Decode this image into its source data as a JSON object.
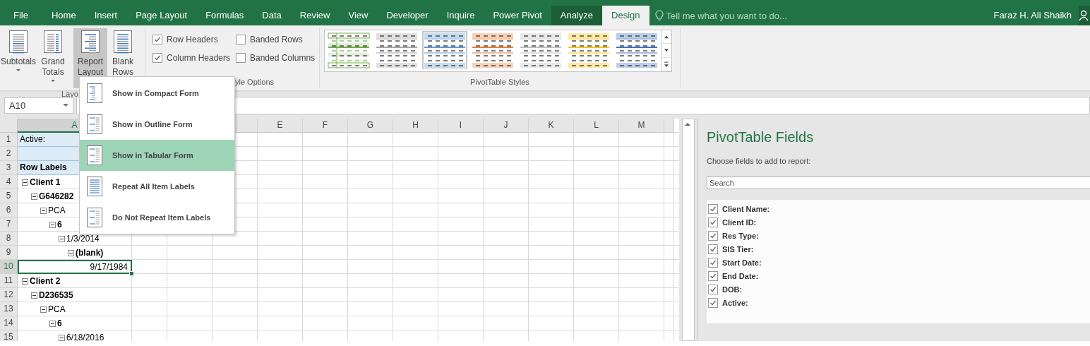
{
  "ribbon_tabs": [
    {
      "label": "File",
      "selected": false,
      "kind": "file"
    },
    {
      "label": "Home",
      "selected": false,
      "kind": "tab"
    },
    {
      "label": "Insert",
      "selected": false,
      "kind": "tab"
    },
    {
      "label": "Page Layout",
      "selected": false,
      "kind": "tab"
    },
    {
      "label": "Formulas",
      "selected": false,
      "kind": "tab"
    },
    {
      "label": "Data",
      "selected": false,
      "kind": "tab"
    },
    {
      "label": "Review",
      "selected": false,
      "kind": "tab"
    },
    {
      "label": "View",
      "selected": false,
      "kind": "tab"
    },
    {
      "label": "Developer",
      "selected": false,
      "kind": "tab"
    },
    {
      "label": "Inquire",
      "selected": false,
      "kind": "tab"
    },
    {
      "label": "Power Pivot",
      "selected": false,
      "kind": "tab"
    },
    {
      "label": "Analyze",
      "selected": false,
      "kind": "contextual"
    },
    {
      "label": "Design",
      "selected": true,
      "kind": "contextual"
    }
  ],
  "tell_me": {
    "placeholder": "Tell me what you want to do..."
  },
  "user_name": "Faraz H. Ali Shaikh",
  "layout_group": {
    "label": "Layo",
    "buttons": [
      {
        "label": "Subtotals",
        "pressed": false
      },
      {
        "label": "Grand Totals",
        "pressed": false
      },
      {
        "label": "Report Layout",
        "pressed": true
      },
      {
        "label": "Blank Rows",
        "pressed": false
      }
    ]
  },
  "style_options_group": {
    "label": "yle Options",
    "options": [
      {
        "label": "Row Headers",
        "checked": true
      },
      {
        "label": "Column Headers",
        "checked": true
      },
      {
        "label": "Banded Rows",
        "checked": false
      },
      {
        "label": "Banded Columns",
        "checked": false
      }
    ]
  },
  "styles_group": {
    "label": "PivotTable Styles",
    "styles": [
      {
        "color": "#70ad47",
        "selected": false
      },
      {
        "color": "#a5a5a5",
        "selected": false
      },
      {
        "color": "#5b9bd5",
        "selected": true
      },
      {
        "color": "#ed7d31",
        "selected": false
      },
      {
        "color": "#bfbfbf",
        "selected": false
      },
      {
        "color": "#ffc000",
        "selected": false
      },
      {
        "color": "#4472c4",
        "selected": false
      }
    ]
  },
  "report_layout_menu": [
    {
      "label": "Show in Compact Form",
      "selected": false,
      "kind": "compact"
    },
    {
      "label": "Show in Outline Form",
      "selected": false,
      "kind": "outline"
    },
    {
      "label": "Show in Tabular Form",
      "selected": true,
      "kind": "tabular"
    },
    {
      "label": "Repeat All Item Labels",
      "selected": false,
      "kind": "repeat"
    },
    {
      "label": "Do Not Repeat Item Labels",
      "selected": false,
      "kind": "norepeat"
    }
  ],
  "name_box": "A10",
  "column_headers": [
    {
      "label": "A",
      "selected": true
    },
    {
      "label": "E",
      "selected": false
    },
    {
      "label": "F",
      "selected": false
    },
    {
      "label": "G",
      "selected": false
    },
    {
      "label": "H",
      "selected": false
    },
    {
      "label": "I",
      "selected": false
    },
    {
      "label": "J",
      "selected": false
    },
    {
      "label": "K",
      "selected": false
    },
    {
      "label": "L",
      "selected": false
    },
    {
      "label": "M",
      "selected": false
    }
  ],
  "row_numbers": [
    "1",
    "2",
    "3",
    "4",
    "5",
    "6",
    "7",
    "8",
    "9",
    "10",
    "11",
    "12",
    "13",
    "14",
    "15"
  ],
  "pivot": {
    "filter_label": "Active:",
    "header": "Row Labels",
    "items": [
      {
        "kind": "item",
        "label": "Client 1",
        "bold": true,
        "expanded": true,
        "selected": false,
        "children": [
          {
            "kind": "item",
            "label": "G646282",
            "bold": true,
            "expanded": true,
            "selected": false,
            "children": [
              {
                "kind": "item",
                "label": "PCA",
                "bold": false,
                "expanded": true,
                "selected": false,
                "children": [
                  {
                    "kind": "item",
                    "label": "6",
                    "bold": true,
                    "expanded": true,
                    "selected": false,
                    "children": [
                      {
                        "kind": "item",
                        "label": "1/3/2014",
                        "bold": false,
                        "expanded": true,
                        "selected": false,
                        "children": [
                          {
                            "kind": "item",
                            "label": "(blank)",
                            "bold": true,
                            "expanded": true,
                            "selected": false,
                            "children": [
                              {
                                "kind": "value",
                                "label": "9/17/1984",
                                "bold": false,
                                "selected": true
                              }
                            ]
                          }
                        ]
                      }
                    ]
                  }
                ]
              }
            ]
          }
        ]
      },
      {
        "kind": "item",
        "label": "Client 2",
        "bold": true,
        "expanded": true,
        "selected": false,
        "children": [
          {
            "kind": "item",
            "label": "D236535",
            "bold": true,
            "expanded": true,
            "selected": false,
            "children": [
              {
                "kind": "item",
                "label": "PCA",
                "bold": false,
                "expanded": true,
                "selected": false,
                "children": [
                  {
                    "kind": "item",
                    "label": "6",
                    "bold": true,
                    "expanded": true,
                    "selected": false,
                    "children": [
                      {
                        "kind": "item",
                        "label": "6/18/2016",
                        "bold": false,
                        "expanded": true,
                        "selected": false
                      }
                    ]
                  }
                ]
              }
            ]
          }
        ]
      }
    ]
  },
  "fields_pane": {
    "title": "PivotTable Fields",
    "subtitle": "Choose fields to add to report:",
    "search": {
      "placeholder": "Search"
    },
    "fields": [
      {
        "label": "Client Name:",
        "checked": true
      },
      {
        "label": "Client ID:",
        "checked": true
      },
      {
        "label": "Res Type:",
        "checked": true
      },
      {
        "label": "SIS Tier:",
        "checked": true
      },
      {
        "label": "Start Date:",
        "checked": true
      },
      {
        "label": "End Date:",
        "checked": true
      },
      {
        "label": "DOB:",
        "checked": true
      },
      {
        "label": "Active:",
        "checked": true
      }
    ]
  }
}
